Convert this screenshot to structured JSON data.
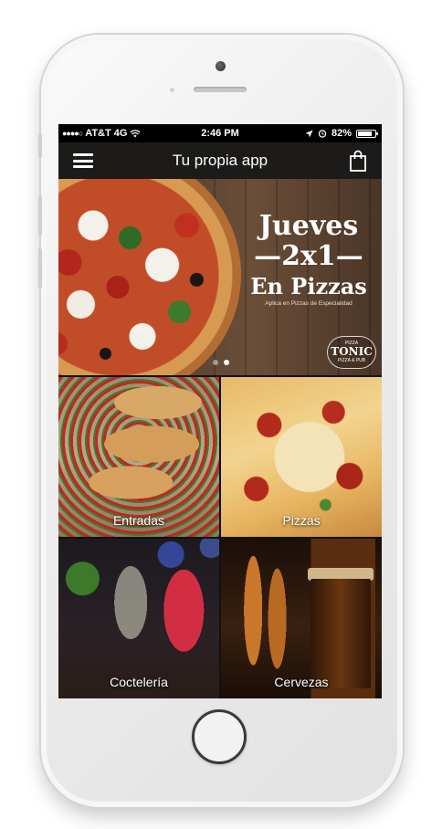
{
  "status_bar": {
    "carrier": "AT&T 4G",
    "time": "2:46 PM",
    "battery": "82%",
    "battery_level": 0.82,
    "icons": [
      "signal-dots-icon",
      "wifi-icon",
      "location-arrow-icon",
      "alarm-icon",
      "battery-icon"
    ]
  },
  "nav": {
    "title": "Tu propia app",
    "menu_icon": "hamburger-menu-icon",
    "cart_icon": "shopping-bag-icon"
  },
  "banner": {
    "line1": "Jueves",
    "line2": "—2x1—",
    "line3": "En Pizzas",
    "subtitle": "Aplica en Pizzas de Especialidad",
    "seal_top": "PIZZA",
    "seal_brand": "TONIC",
    "seal_bottom": "PIZZA & PUB",
    "page_count": 2,
    "active_page": 2
  },
  "tiles": [
    {
      "label": "Entradas"
    },
    {
      "label": "Pizzas"
    },
    {
      "label": "Coctelería"
    },
    {
      "label": "Cervezas"
    }
  ],
  "colors": {
    "nav_background": "#1c1b19",
    "status_background": "#000000",
    "text_light": "#ffffff"
  }
}
